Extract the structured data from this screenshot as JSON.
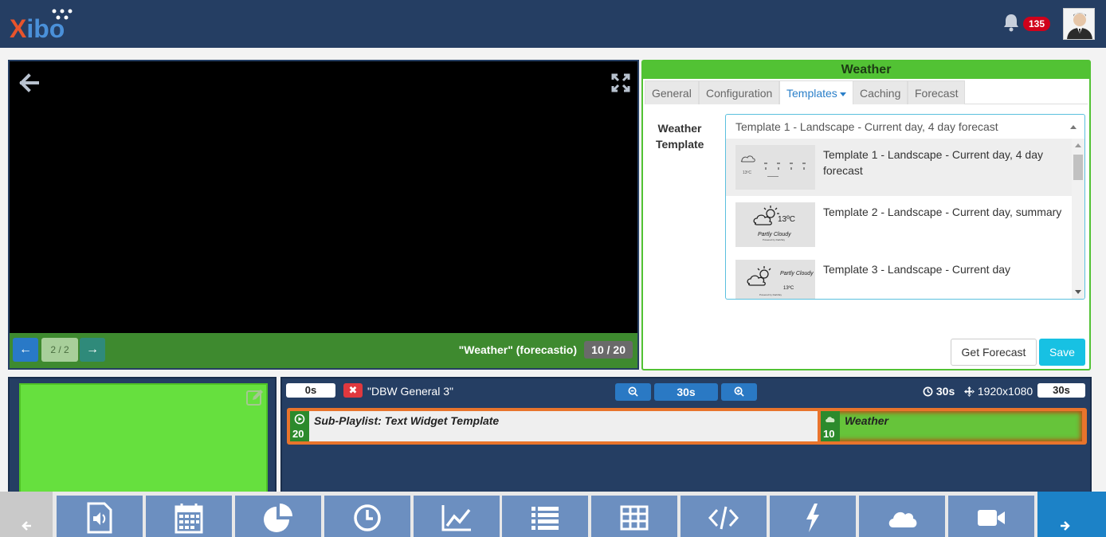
{
  "header": {
    "logo_x": "X",
    "logo_rest": "ibo",
    "notification_count": "135"
  },
  "preview": {
    "page_indicator": "2 / 2",
    "widget_name": "\"Weather\" (forecastio)",
    "widget_count": "10 / 20",
    "prev_label": "←",
    "next_label": "→"
  },
  "properties": {
    "title": "Weather",
    "tabs": [
      {
        "label": "General"
      },
      {
        "label": "Configuration"
      },
      {
        "label": "Templates"
      },
      {
        "label": "Caching"
      },
      {
        "label": "Forecast"
      }
    ],
    "field_label": "Weather Template",
    "selected_value": "Template 1 - Landscape - Current day, 4 day forecast",
    "options": [
      {
        "label": "Template 1 - Landscape - Current day, 4 day forecast"
      },
      {
        "label": "Template 2 - Landscape - Current day, summary"
      },
      {
        "label": "Template 3 - Landscape - Current day"
      }
    ],
    "thumb2_temp": "13ºC",
    "thumb2_desc": "Partly Cloudy",
    "thumb2_credit": "Powered by DarkSky",
    "thumb3_desc": "Partly Cloudy",
    "thumb3_temp": "13ºC",
    "thumb3_credit": "Powered by DarkSky",
    "thumb1_temp": "13ºC",
    "get_forecast_label": "Get Forecast",
    "save_label": "Save"
  },
  "timeline": {
    "start_time": "0s",
    "region_name": "\"DBW General 3\"",
    "zoom_value": "30s",
    "duration": "30s",
    "resolution": "1920x1080",
    "end_time": "30s",
    "widgets": [
      {
        "label": "Sub-Playlist: Text Widget Template",
        "count": "20"
      },
      {
        "label": "Weather",
        "count": "10"
      }
    ]
  },
  "colors": {
    "header_bg": "#253e63",
    "accent_green": "#52c234",
    "accent_blue": "#2a79c4",
    "save_cyan": "#17c1e3",
    "track_orange": "#e8742c"
  }
}
